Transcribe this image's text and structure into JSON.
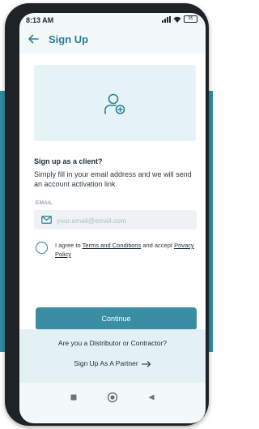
{
  "status_bar": {
    "time": "8:13 AM",
    "battery": "95"
  },
  "app_bar": {
    "title": "Sign Up"
  },
  "form": {
    "heading": "Sign up as a client?",
    "description": "Simply fill in your email address and we will send an account activation link.",
    "email_label": "EMAIL",
    "email_placeholder": "your.email@email.com",
    "email_value": "",
    "agree_prefix": "I agree to ",
    "terms_link": "Terms and Conditions",
    "agree_middle": " and accept ",
    "privacy_link": "Privacy Policy",
    "continue_label": "Continue"
  },
  "partner": {
    "question": "Are you a Distributor or Contractor?",
    "link": "Sign Up As A Partner"
  },
  "icons": {
    "back": "arrow-left-icon",
    "avatar": "user-add-icon",
    "mail": "mail-icon",
    "partner_arrow": "arrow-right-icon"
  },
  "colors": {
    "accent": "#2b7f97",
    "button": "#3b8da4",
    "backdrop": "#2f8ea3"
  }
}
